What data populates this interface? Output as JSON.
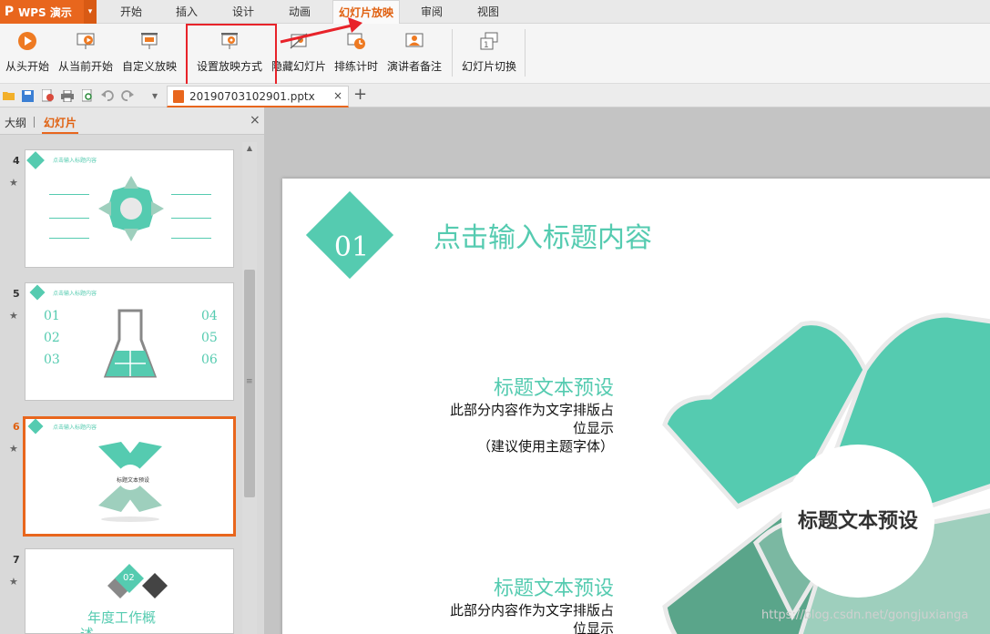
{
  "app": {
    "logo": "P",
    "name": "WPS 演示",
    "caret": "▾"
  },
  "menu": {
    "tabs": [
      "开始",
      "插入",
      "设计",
      "动画",
      "幻灯片放映",
      "审阅",
      "视图"
    ],
    "active": "幻灯片放映"
  },
  "ribbon": {
    "buttons": [
      "从头开始",
      "从当前开始",
      "自定义放映",
      "设置放映方式",
      "隐藏幻灯片",
      "排练计时",
      "演讲者备注",
      "幻灯片切换"
    ]
  },
  "quick_access": {
    "more": "▾"
  },
  "document_tab": {
    "filename": "20190703102901.pptx",
    "close": "×",
    "new_tab": "+"
  },
  "left_panel": {
    "tab_outline": "大纲",
    "tab_slides": "幻灯片",
    "close": "×",
    "slides": [
      {
        "number": "4",
        "star": "★",
        "title": "点击输入标题内容"
      },
      {
        "number": "5",
        "star": "★",
        "title": "点击输入标题内容",
        "numbers_left": [
          "01",
          "02",
          "03"
        ],
        "numbers_right": [
          "04",
          "05",
          "06"
        ]
      },
      {
        "number": "6",
        "star": "★",
        "title": "点击输入标题内容",
        "center": "标题文本预设"
      },
      {
        "number": "7",
        "star": "★",
        "badge": "02",
        "caption_line1": "年度工作概",
        "caption_line2": "述"
      }
    ],
    "active_slide": "6"
  },
  "slide": {
    "number": "01",
    "title": "点击输入标题内容",
    "blocks": [
      {
        "title": "标题文本预设",
        "line1": "此部分内容作为文字排版占",
        "line2": "位显示",
        "line3": "（建议使用主题字体）"
      },
      {
        "title": "标题文本预设",
        "line1": "此部分内容作为文字排版占",
        "line2": "位显示"
      }
    ],
    "center_label": "标题文本预设"
  },
  "watermark": "https://blog.csdn.net/gongjuxianga",
  "colors": {
    "accent": "#e8661d",
    "teal": "#55cbb0",
    "highlight": "#e8232a"
  }
}
